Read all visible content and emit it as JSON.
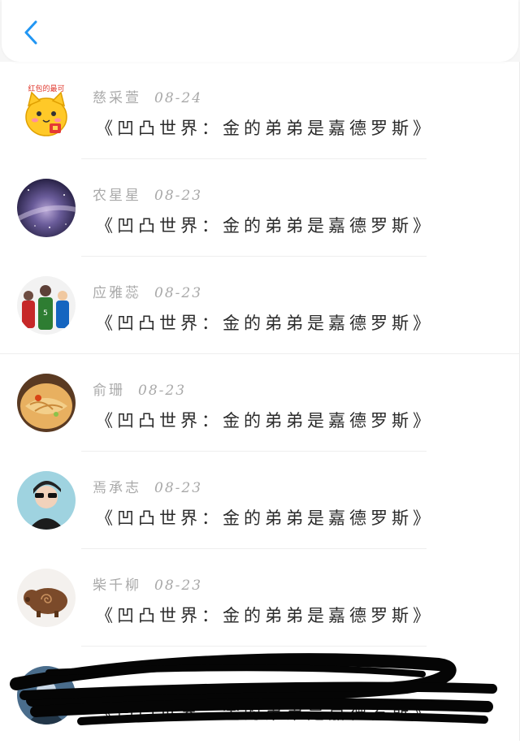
{
  "header": {
    "back_icon": "chevron-left-icon",
    "accent": "#2196f3"
  },
  "comments": [
    {
      "name": "慈采萱",
      "date": "08-24",
      "message": "《凹凸世界：金的弟弟是嘉德罗斯》",
      "avatar_badge": "红包的最可"
    },
    {
      "name": "农星星",
      "date": "08-23",
      "message": "《凹凸世界：金的弟弟是嘉德罗斯》"
    },
    {
      "name": "应雅蕊",
      "date": "08-23",
      "message": "《凹凸世界：金的弟弟是嘉德罗斯》"
    },
    {
      "name": "俞珊",
      "date": "08-23",
      "message": "《凹凸世界：金的弟弟是嘉德罗斯》"
    },
    {
      "name": "焉承志",
      "date": "08-23",
      "message": "《凹凸世界：金的弟弟是嘉德罗斯》"
    },
    {
      "name": "柴千柳",
      "date": "08-23",
      "message": "《凹凸世界：金的弟弟是嘉德罗斯》"
    },
    {
      "name": "",
      "date": "",
      "message": "《凹凸世界：金的弟弟是嘉德罗斯》",
      "redacted": true
    }
  ]
}
